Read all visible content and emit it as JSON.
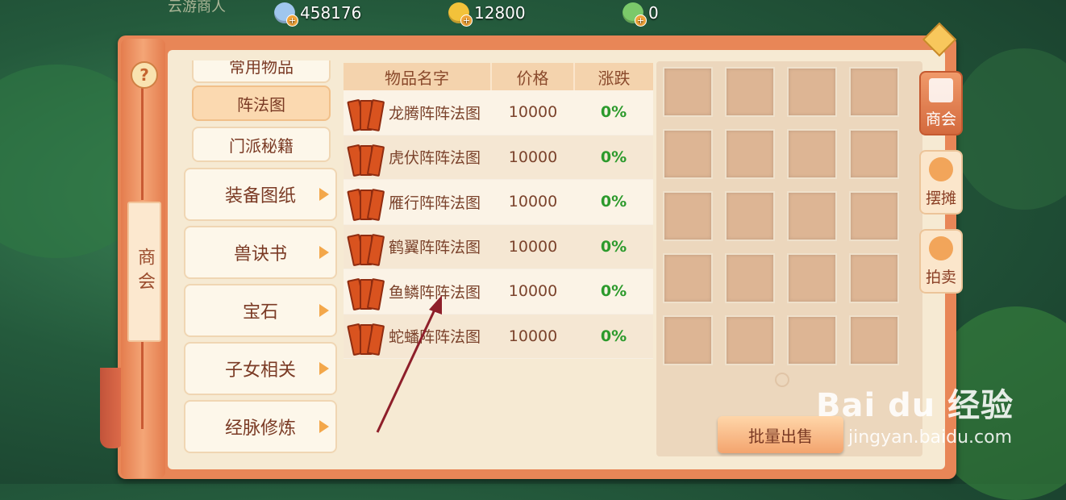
{
  "top": {
    "title": "云游商人",
    "currencies": [
      {
        "icon": "silver-coin-icon",
        "value": "458176",
        "color": "#9fc6ee"
      },
      {
        "icon": "gold-coin-icon",
        "value": "12800",
        "color": "#f3c23a"
      },
      {
        "icon": "jade-coin-icon",
        "value": "0",
        "color": "#7bc96a"
      }
    ]
  },
  "rail": {
    "help": "?",
    "label": "商会"
  },
  "categories": [
    {
      "label": "常用物品",
      "type": "sub",
      "selected": false
    },
    {
      "label": "阵法图",
      "type": "sub",
      "selected": true
    },
    {
      "label": "门派秘籍",
      "type": "sub",
      "selected": false
    },
    {
      "label": "装备图纸",
      "type": "main"
    },
    {
      "label": "兽诀书",
      "type": "main"
    },
    {
      "label": "宝石",
      "type": "main"
    },
    {
      "label": "子女相关",
      "type": "main"
    },
    {
      "label": "经脉修炼",
      "type": "main"
    }
  ],
  "table": {
    "headers": {
      "name": "物品名字",
      "price": "价格",
      "change": "涨跌"
    },
    "rows": [
      {
        "name": "龙腾阵阵法图",
        "price": "10000",
        "change": "0%"
      },
      {
        "name": "虎伏阵阵法图",
        "price": "10000",
        "change": "0%"
      },
      {
        "name": "雁行阵阵法图",
        "price": "10000",
        "change": "0%"
      },
      {
        "name": "鹤翼阵阵法图",
        "price": "10000",
        "change": "0%"
      },
      {
        "name": "鱼鳞阵阵法图",
        "price": "10000",
        "change": "0%"
      },
      {
        "name": "蛇蟠阵阵法图",
        "price": "10000",
        "change": "0%"
      }
    ]
  },
  "bulk_sell": "批量出售",
  "side_tabs": [
    {
      "label": "商会",
      "icon": "guild-icon",
      "active": true
    },
    {
      "label": "摆摊",
      "icon": "stall-coins-icon",
      "active": false
    },
    {
      "label": "拍卖",
      "icon": "auction-coins-icon",
      "active": false
    }
  ],
  "watermark": {
    "main": "Bai du 经验",
    "sub": "jingyan.baidu.com"
  },
  "colors": {
    "frame": "#e88657",
    "panel": "#f6ead3",
    "change_green": "#2c9a2c",
    "arrow": "#8e1f2a"
  }
}
